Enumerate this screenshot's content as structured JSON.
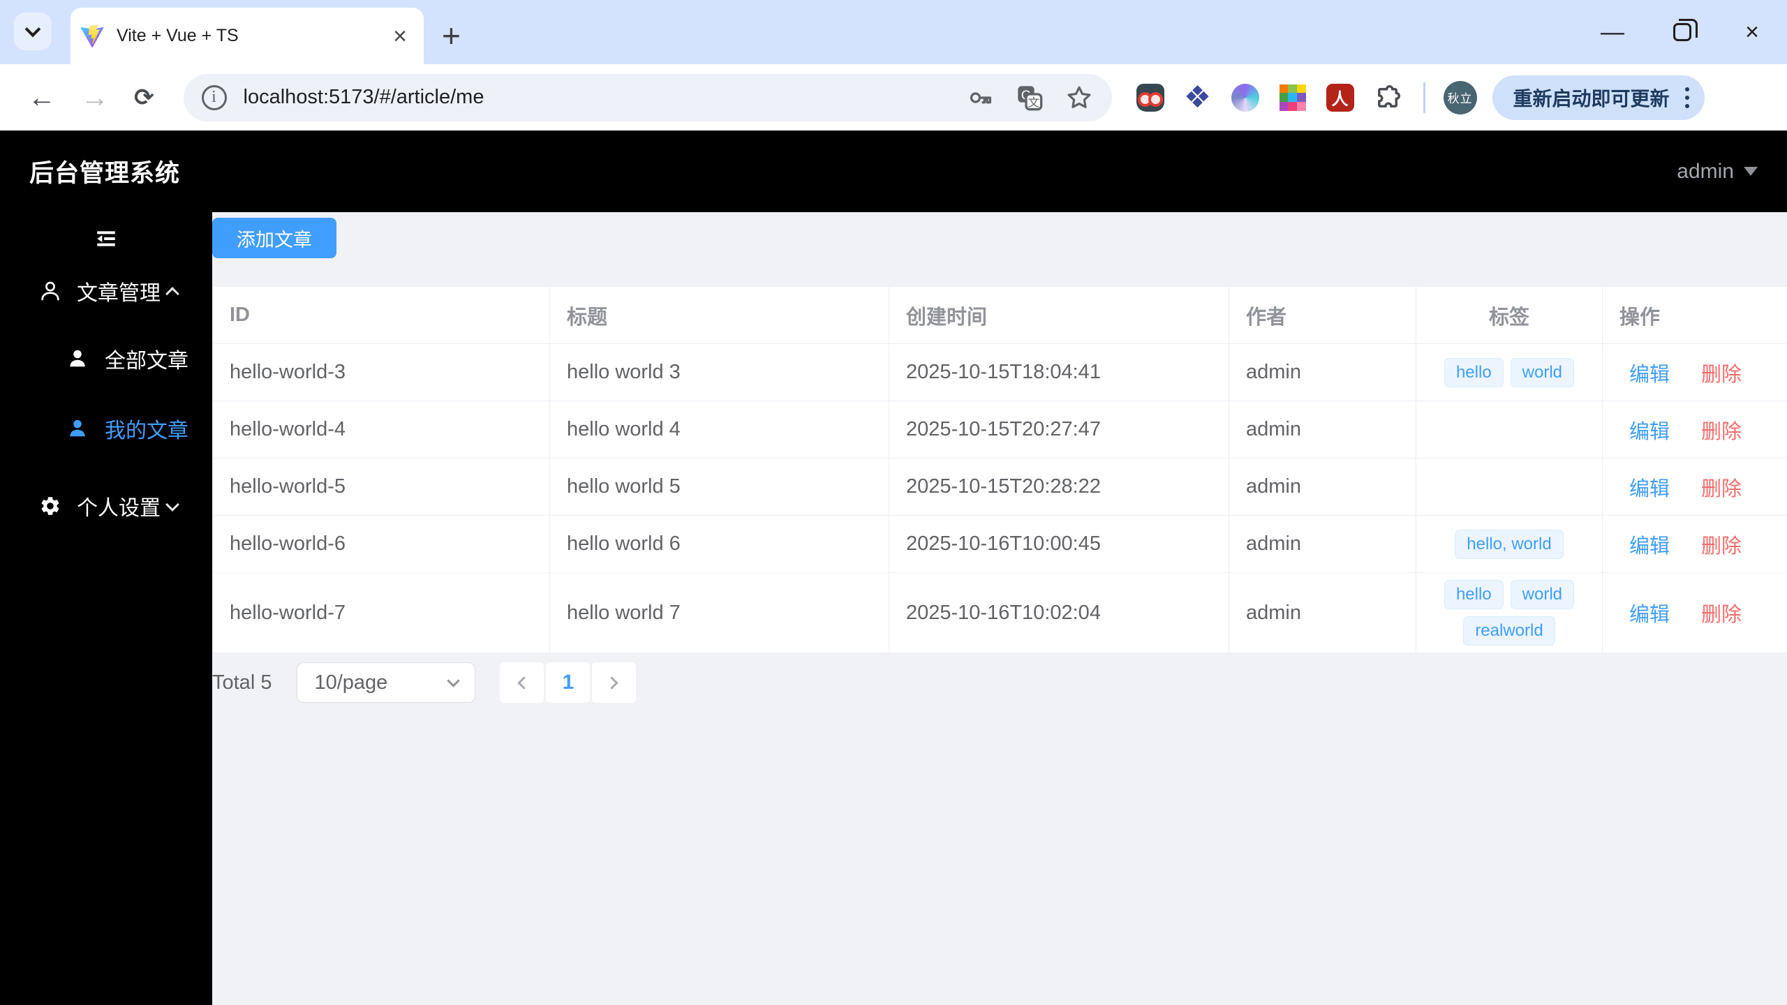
{
  "browser": {
    "tab_title": "Vite + Vue + TS",
    "url": "localhost:5173/#/article/me",
    "profile_name": "秋立",
    "update_button_label": "重新启动即可更新",
    "new_tab_label": "+",
    "tab_close_label": "×",
    "minimize_label": "—",
    "close_label": "×",
    "pdf_glyph": "人",
    "clover_glyph": "❖",
    "info_glyph": "i",
    "back_glyph": "←",
    "forward_glyph": "→",
    "reload_glyph": "⟳"
  },
  "app": {
    "title": "后台管理系统",
    "user_menu_label": "admin",
    "sidebar": {
      "group1_label": "文章管理",
      "item_all_label": "全部文章",
      "item_mine_label": "我的文章",
      "group2_label": "个人设置"
    },
    "add_button_label": "添加文章",
    "table": {
      "headers": [
        "ID",
        "标题",
        "创建时间",
        "作者",
        "标签",
        "操作"
      ],
      "action_labels": {
        "edit": "编辑",
        "delete": "删除"
      },
      "rows": [
        {
          "id": "hello-world-3",
          "title": "hello world 3",
          "created": "2025-10-15T18:04:41",
          "author": "admin",
          "tags": [
            "hello",
            "world"
          ]
        },
        {
          "id": "hello-world-4",
          "title": "hello world 4",
          "created": "2025-10-15T20:27:47",
          "author": "admin",
          "tags": []
        },
        {
          "id": "hello-world-5",
          "title": "hello world 5",
          "created": "2025-10-15T20:28:22",
          "author": "admin",
          "tags": []
        },
        {
          "id": "hello-world-6",
          "title": "hello world 6",
          "created": "2025-10-16T10:00:45",
          "author": "admin",
          "tags": [
            "hello, world"
          ]
        },
        {
          "id": "hello-world-7",
          "title": "hello world 7",
          "created": "2025-10-16T10:02:04",
          "author": "admin",
          "tags": [
            "hello",
            "world",
            "realworld"
          ]
        }
      ]
    },
    "pagination": {
      "total_label": "Total 5",
      "page_size_label": "10/page",
      "current_page": "1"
    }
  },
  "colors": {
    "accent_blue": "#409eff",
    "danger_red": "#f56c6c",
    "tag_bg": "#ecf5ff",
    "tab_strip": "#d3e2fd",
    "content_bg": "#f0f2f5",
    "sidebar_bg": "#000000"
  }
}
